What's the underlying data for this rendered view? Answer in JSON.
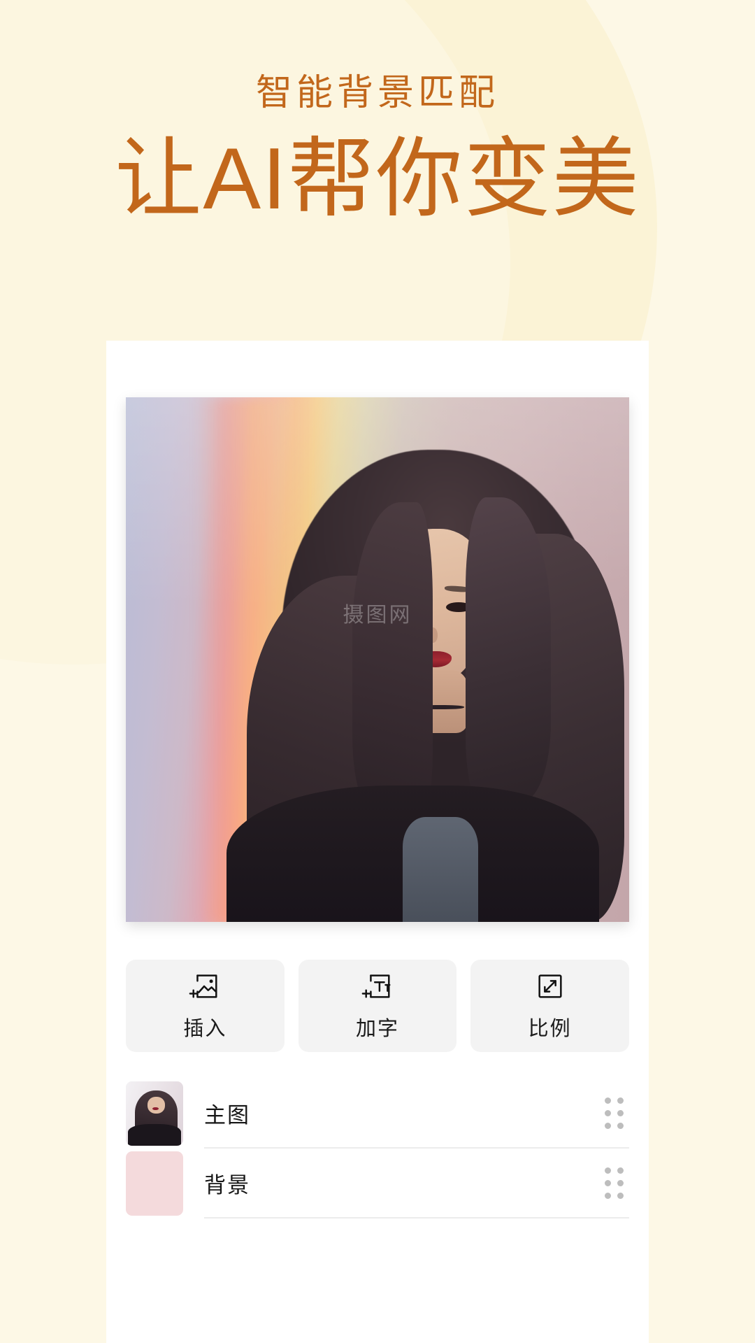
{
  "promo": {
    "subtitle": "智能背景匹配",
    "title": "让AI帮你变美",
    "accent_color": "#C2671B",
    "page_background": "#FDF8E6"
  },
  "canvas": {
    "watermark": "摄图网",
    "background_label": "rainbow-prism-gradient",
    "subject_label": "woman-portrait-long-dark-hair"
  },
  "toolbar": {
    "buttons": [
      {
        "label": "插入",
        "icon": "image-add-icon"
      },
      {
        "label": "加字",
        "icon": "text-add-icon"
      },
      {
        "label": "比例",
        "icon": "resize-ratio-icon"
      }
    ]
  },
  "layers": {
    "rows": [
      {
        "name": "主图",
        "thumb_type": "photo",
        "handle": "drag-handle-icon"
      },
      {
        "name": "背景",
        "thumb_type": "color",
        "thumb_color": "#F4DADC",
        "handle": "drag-handle-icon"
      }
    ]
  }
}
